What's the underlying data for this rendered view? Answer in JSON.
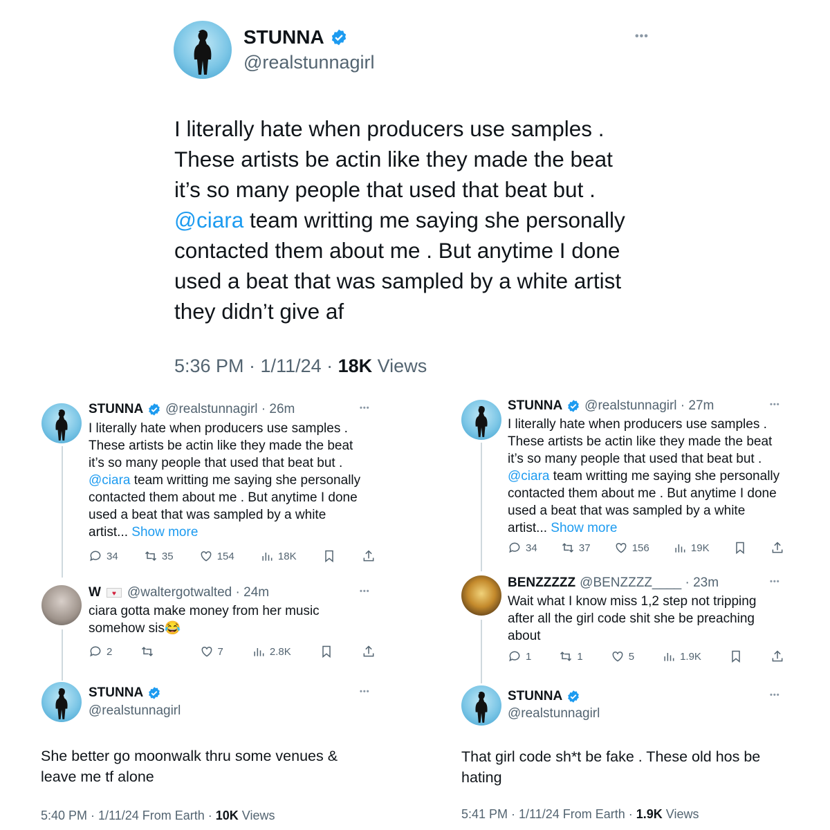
{
  "main": {
    "name": "STUNNA",
    "handle": "@realstunnagirl",
    "more": "•••",
    "text_lines": [
      "I literally hate when producers use samples .",
      "These artists be actin like they made the beat",
      "it’s so many people that used that beat but ."
    ],
    "mention": "@ciara",
    "mention_rest": " team writting me saying she personally",
    "text_lines2": [
      "contacted them about me . But anytime I done",
      "used a beat that was sampled by a white artist",
      "they didn’t give af"
    ],
    "meta_time": "5:36 PM · 1/11/24 · ",
    "meta_views_count": "18K",
    "meta_views_label": " Views"
  },
  "left": {
    "tweet1": {
      "name": "STUNNA",
      "handle_time": "@realstunnagirl · 26m",
      "lines": [
        "I literally hate when producers use samples .",
        "These artists be actin like they made the beat",
        "it’s so many people that used that beat but ."
      ],
      "mention": "@ciara",
      "mention_rest": " team writting me saying she personally",
      "lines2": [
        "contacted them about me . But anytime I done",
        "used a beat that was sampled by a white"
      ],
      "last": "artist... ",
      "show_more": "Show more",
      "replies": "34",
      "retweets": "35",
      "likes": "154",
      "views": "18K"
    },
    "tweet2": {
      "name": "W",
      "handle_time": "@waltergotwalted · 24m",
      "lines": [
        "ciara gotta make money from her music",
        "somehow sis😂"
      ],
      "replies": "2",
      "retweets": "",
      "likes": "7",
      "views": "2.8K"
    },
    "tweet3": {
      "name": "STUNNA",
      "handle": "@realstunnagirl",
      "lines": [
        "She better go moonwalk thru some venues &",
        "leave me tf alone"
      ],
      "meta_time": "5:40 PM · 1/11/24 From Earth · ",
      "views_count": "10K",
      "views_label": " Views"
    }
  },
  "right": {
    "tweet1": {
      "name": "STUNNA",
      "handle_time": "@realstunnagirl · 27m",
      "lines": [
        "I literally hate when producers use samples .",
        "These artists be actin like they made the beat",
        "it’s so many people that used that beat but ."
      ],
      "mention": "@ciara",
      "mention_rest": " team writting me saying she personally",
      "lines2": [
        "contacted them about me . But anytime I done",
        "used a beat that was sampled by a white"
      ],
      "last": "artist... ",
      "show_more": "Show more",
      "replies": "34",
      "retweets": "37",
      "likes": "156",
      "views": "19K"
    },
    "tweet2": {
      "name": "BENZZZZZ",
      "handle_time": "@BENZZZZ____ · 23m",
      "lines": [
        "Wait what I know miss 1,2 step not tripping",
        "after all the girl code shit she be preaching",
        "about"
      ],
      "replies": "1",
      "retweets": "1",
      "likes": "5",
      "views": "1.9K"
    },
    "tweet3": {
      "name": "STUNNA",
      "handle": "@realstunnagirl",
      "lines": [
        "That girl code sh*t be fake . These old hos be",
        "hating"
      ],
      "meta_time": "5:41 PM · 1/11/24 From Earth · ",
      "views_count": "1.9K",
      "views_label": " Views"
    }
  },
  "icons": {
    "verified_color": "#1d9bf0",
    "reply": "reply-icon",
    "retweet": "retweet-icon",
    "like": "heart-icon",
    "views": "views-icon",
    "bookmark": "bookmark-icon",
    "share": "share-icon"
  },
  "colors": {
    "link": "#1d9bf0",
    "muted": "#536471",
    "text": "#0f1419"
  }
}
